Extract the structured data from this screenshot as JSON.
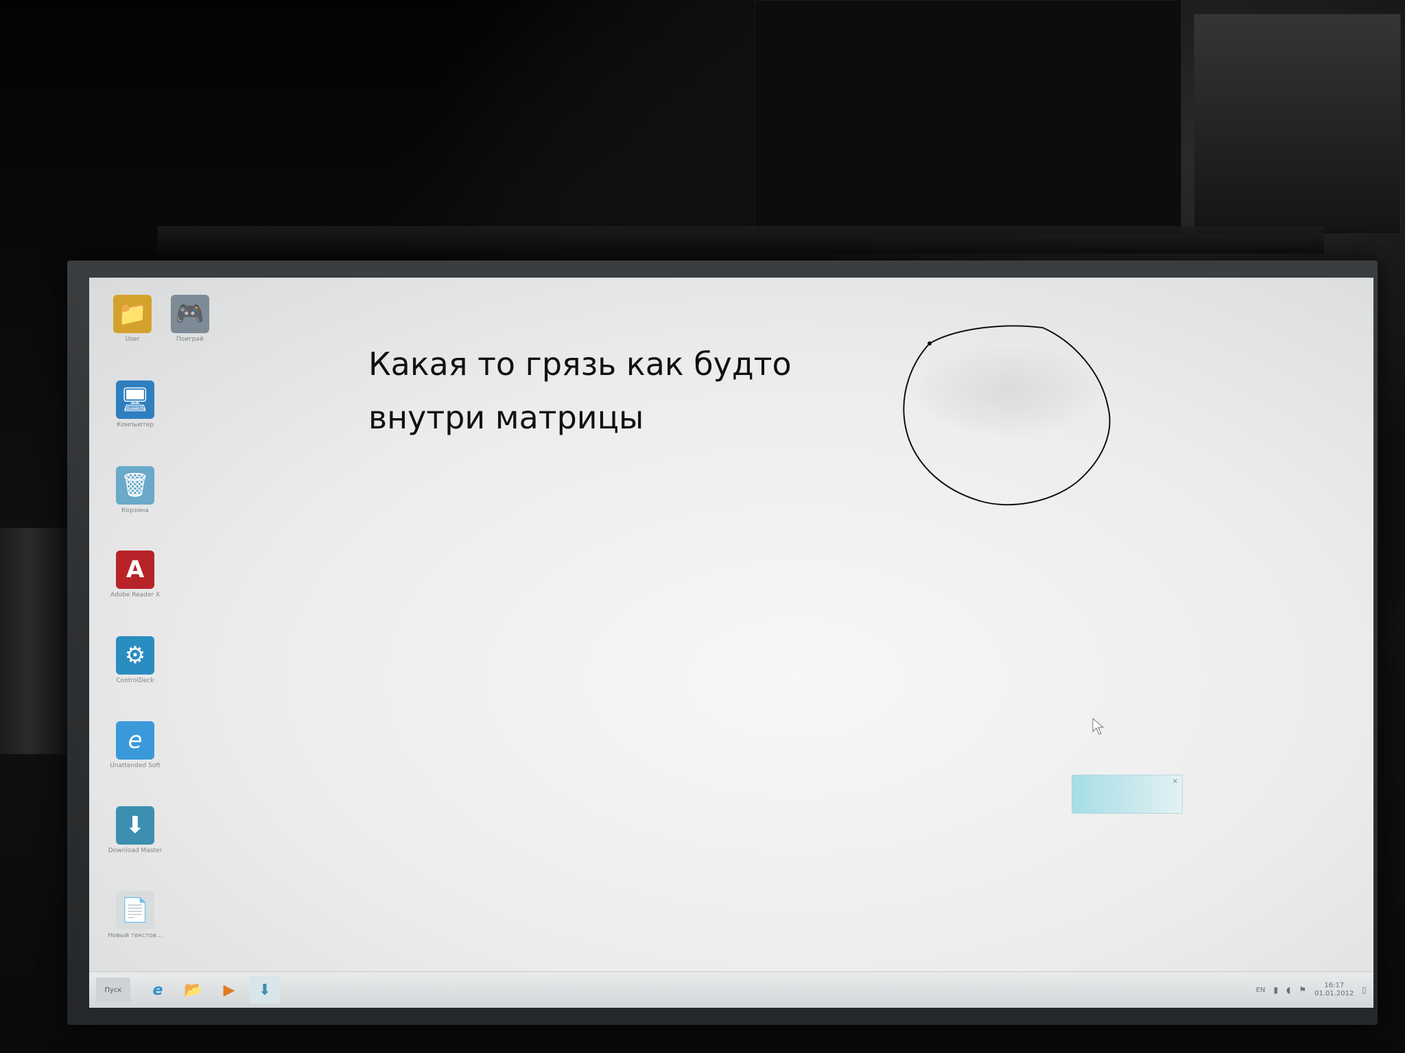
{
  "annotation": {
    "line1": "Какая то грязь как будто",
    "line2": "внутри матрицы"
  },
  "desktop": {
    "icons": [
      {
        "label": "User",
        "icon": "folder-icon",
        "glyph": "📁",
        "color": "#d4a22c"
      },
      {
        "label": "Поиграй",
        "icon": "gamepad-icon",
        "glyph": "🎮",
        "color": "#7d8b96"
      },
      {
        "label": "Компьютер",
        "icon": "computer-icon",
        "glyph": "🖥",
        "color": "#2f7fbf"
      },
      {
        "label": "Корзина",
        "icon": "recycle-bin-icon",
        "glyph": "🗑",
        "color": "#6aa9c9"
      },
      {
        "label": "Adobe Reader X",
        "icon": "adobe-reader-icon",
        "glyph": "A",
        "color": "#b8232a"
      },
      {
        "label": "ControlDeck",
        "icon": "controldeck-icon",
        "glyph": "⚙",
        "color": "#2a8dbf"
      },
      {
        "label": "Unattended Soft",
        "icon": "ie-icon",
        "glyph": "e",
        "color": "#3a9ad9"
      },
      {
        "label": "Download Master",
        "icon": "download-master-icon",
        "glyph": "⬇",
        "color": "#3c8fb0"
      },
      {
        "label": "Новый текстов...",
        "icon": "text-file-icon",
        "glyph": "📄",
        "color": "#d9dcdd"
      }
    ]
  },
  "taskbar": {
    "start_label": "Пуск",
    "pinned": [
      {
        "icon": "ie-icon",
        "glyph": "e",
        "color": "#2e8fd0"
      },
      {
        "icon": "explorer-folder-icon",
        "glyph": "📂",
        "color": "#cfa548"
      },
      {
        "icon": "media-player-icon",
        "glyph": "▶",
        "color": "#e07a22"
      },
      {
        "icon": "download-master-icon",
        "glyph": "⬇",
        "color": "#3c8fb0"
      }
    ],
    "tray": {
      "language": "EN",
      "time": "16:17",
      "date": "01.01.2012"
    }
  }
}
